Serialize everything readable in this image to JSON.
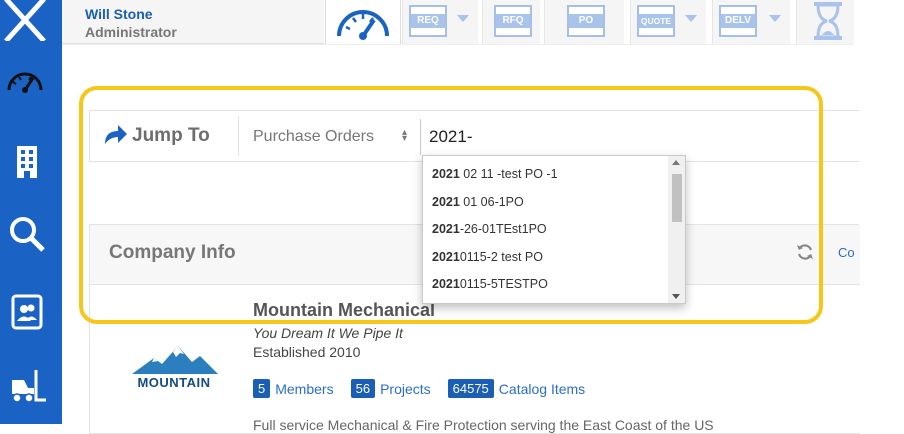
{
  "sidebar": {
    "icons": [
      "close-icon",
      "dashboard-gauge-icon",
      "building-icon",
      "search-icon",
      "contacts-icon",
      "forklift-icon"
    ]
  },
  "header": {
    "user_name": "Will Stone",
    "user_role": "Administrator",
    "tabs": [
      {
        "icon": "dashboard-gauge-icon",
        "label": ""
      },
      {
        "label": "REQ",
        "has_dropdown": true
      },
      {
        "label": "RFQ",
        "has_dropdown": false
      },
      {
        "label": "PO",
        "has_dropdown": false
      },
      {
        "label": "QUOTE",
        "has_dropdown": true
      },
      {
        "label": "DELV",
        "has_dropdown": true
      },
      {
        "icon": "hourglass-icon",
        "label": ""
      }
    ]
  },
  "jump_to": {
    "title": "Jump To",
    "select_value": "Purchase Orders",
    "input_value": "2021-",
    "suggestions": [
      {
        "match": "2021",
        "rest": " 02 11 -test PO -1"
      },
      {
        "match": "2021",
        "rest": " 01 06-1PO"
      },
      {
        "match": "2021",
        "rest": "-26-01TEst1PO"
      },
      {
        "match": "2021",
        "rest": "0115-2 test PO"
      },
      {
        "match": "2021",
        "rest": "0115-5TESTPO"
      }
    ]
  },
  "company": {
    "section_title": "Company Info",
    "link_text": "Co",
    "name": "Mountain Mechanical",
    "tagline": "You Dream It We Pipe It",
    "established": "Established 2010",
    "logo_text": "MOUNTAIN",
    "stats": [
      {
        "count": "5",
        "label": "Members"
      },
      {
        "count": "56",
        "label": "Projects"
      },
      {
        "count": "64575",
        "label": "Catalog Items"
      }
    ],
    "description": "Full service Mechanical & Fire Protection serving the East Coast of the US"
  },
  "colors": {
    "sidebar": "#1a63c5",
    "highlight": "#f6c719",
    "link": "#2a6ec6",
    "badge": "#1b5fb4"
  }
}
